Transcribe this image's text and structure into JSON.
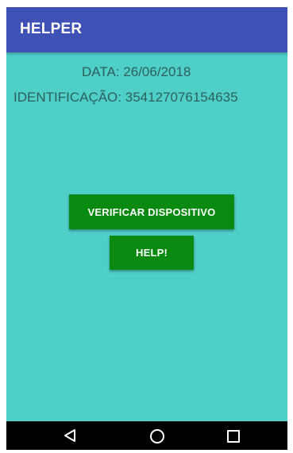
{
  "appbar": {
    "title": "HELPER"
  },
  "info": {
    "date_label": "DATA:",
    "date_value": "26/06/2018",
    "id_label": "IDENTIFICAÇÃO:",
    "id_value": "354127076154635"
  },
  "buttons": {
    "verify_label": "VERIFICAR DISPOSITIVO",
    "help_label": "HELP!"
  },
  "navbar": {
    "back_icon": "back-triangle",
    "home_icon": "home-circle",
    "recent_icon": "recent-square"
  },
  "colors": {
    "appbar": "#3f51b5",
    "background": "#4ecfc8",
    "button": "#0a8a10",
    "text": "#2f5f5b",
    "navbar": "#000000"
  }
}
